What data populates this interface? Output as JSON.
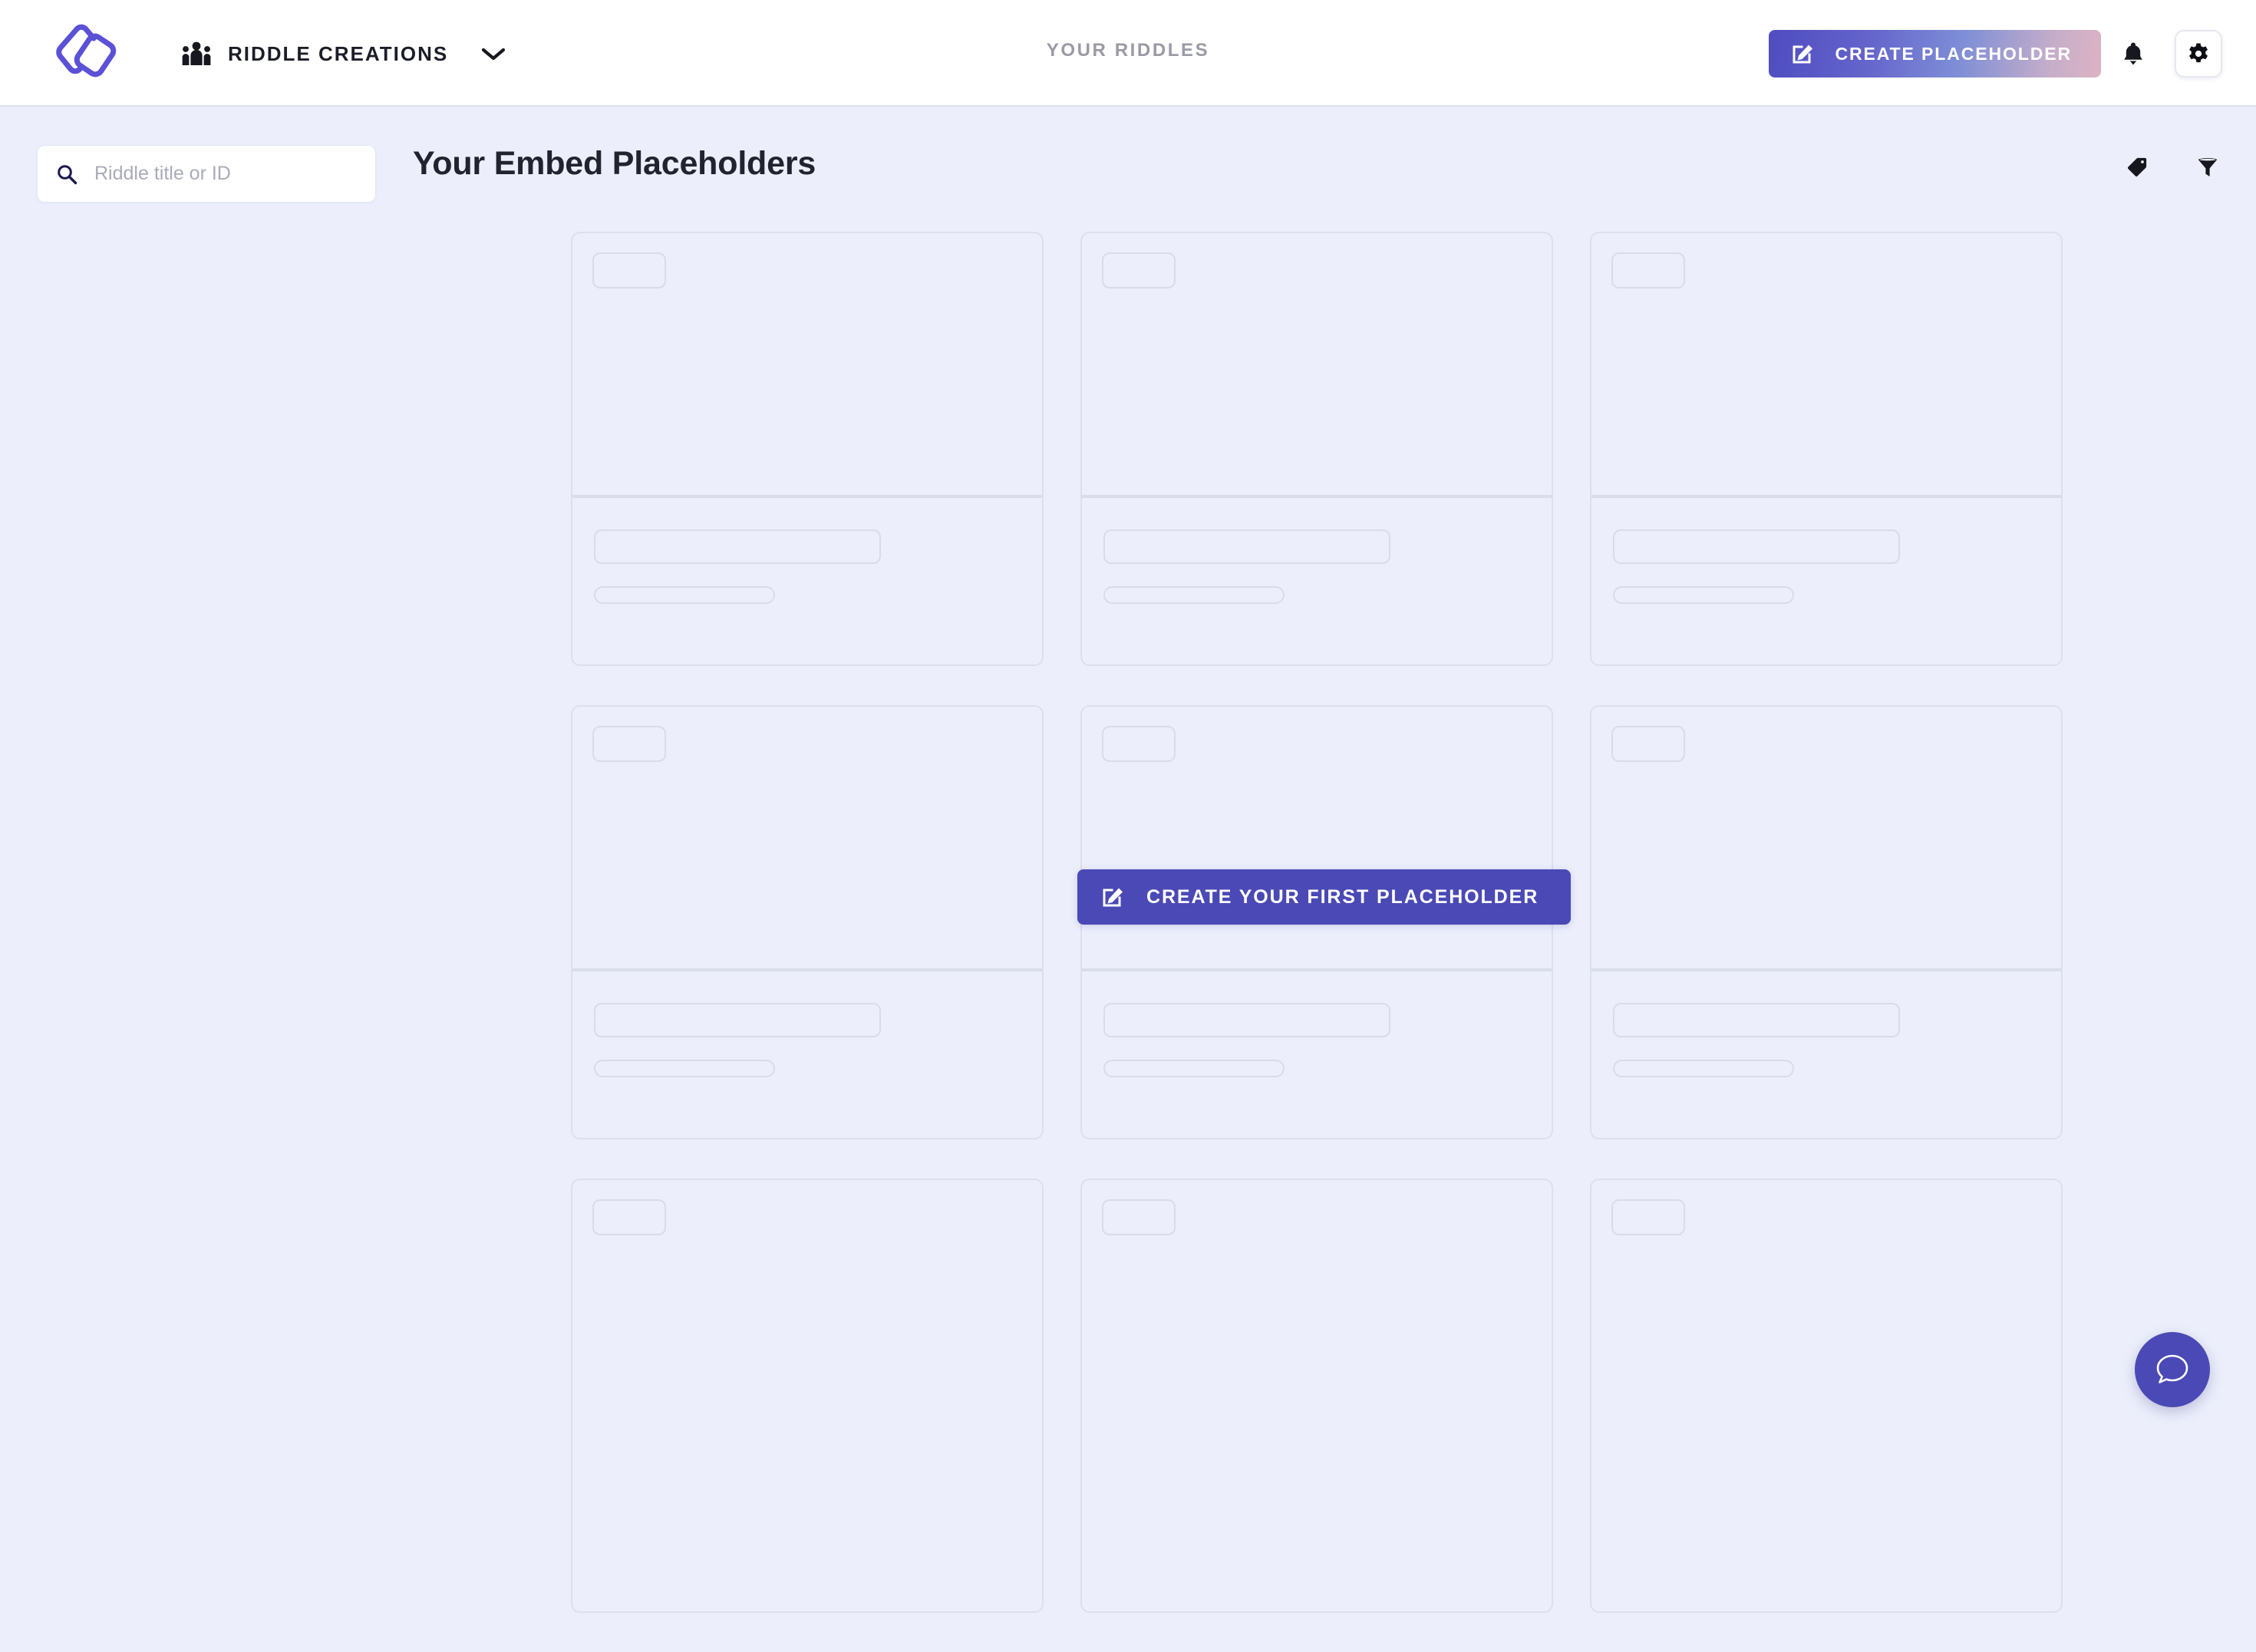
{
  "header": {
    "logo_icon": "riddle-logo-icon",
    "org": {
      "icon": "people-group-icon",
      "name": "RIDDLE CREATIONS",
      "chevron_icon": "chevron-down-icon"
    },
    "context_label": "YOUR RIDDLES",
    "create_button": {
      "label": "CREATE PLACEHOLDER",
      "icon": "edit-square-icon",
      "gradient_from": "#4e4cc0",
      "gradient_to": "#ddb3c3"
    },
    "notifications_icon": "bell-icon",
    "settings_icon": "gear-icon"
  },
  "toolbar": {
    "search": {
      "icon": "search-icon",
      "placeholder": "Riddle title or ID",
      "value": ""
    },
    "tools": [
      {
        "icon": "tag-icon",
        "name": "tag-filter"
      },
      {
        "icon": "filter-icon",
        "name": "filter"
      }
    ]
  },
  "main": {
    "title": "Your Embed Placeholders",
    "empty_state": {
      "cta_label": "CREATE YOUR FIRST PLACEHOLDER",
      "cta_icon": "edit-square-icon",
      "cta_color": "#4a49b5"
    },
    "skeleton": {
      "rows": 3,
      "columns": 3,
      "placeholder_cards": [
        {
          "id": 1
        },
        {
          "id": 2
        },
        {
          "id": 3
        },
        {
          "id": 4
        },
        {
          "id": 5
        },
        {
          "id": 6
        },
        {
          "id": 7
        },
        {
          "id": 8
        },
        {
          "id": 9
        }
      ]
    }
  },
  "support": {
    "chat_icon": "chat-bubble-icon",
    "color": "#4a49b5"
  },
  "theme": {
    "background": "#eceffb",
    "header_background": "#ffffff",
    "accent": "#4a49b5",
    "muted_text": "#9a9aa5",
    "title_text": "#21242f",
    "skeleton_border": "#dddfec"
  }
}
